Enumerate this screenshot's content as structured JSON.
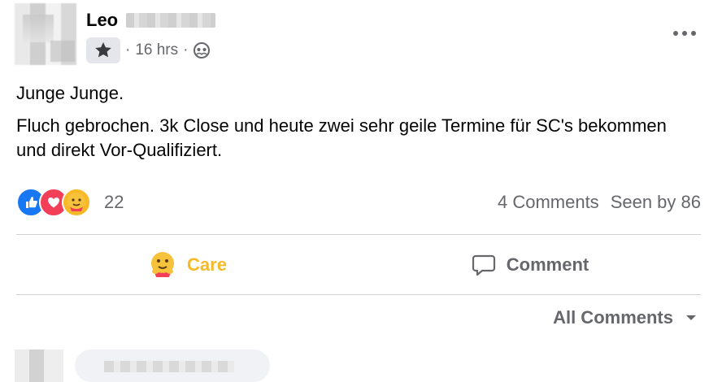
{
  "post": {
    "author_name": "Leo",
    "timestamp": "16 hrs",
    "separator": "·",
    "text_lines": [
      "Junge Junge.",
      "Fluch gebrochen. 3k Close und heute zwei sehr geile Termine für SC's bekommen und direkt Vor-Qualifiziert."
    ],
    "reactions": {
      "icons": [
        "like-icon",
        "love-icon",
        "care-icon"
      ],
      "count": "22"
    },
    "comments_count_label": "4 Comments",
    "seen_by_label": "Seen by 86"
  },
  "actions": {
    "care_label": "Care",
    "comment_label": "Comment"
  },
  "comments_filter": {
    "label": "All Comments"
  },
  "colors": {
    "care": "#f7b928",
    "like": "#1877f2",
    "love": "#f33e58",
    "muted": "#65676b"
  }
}
